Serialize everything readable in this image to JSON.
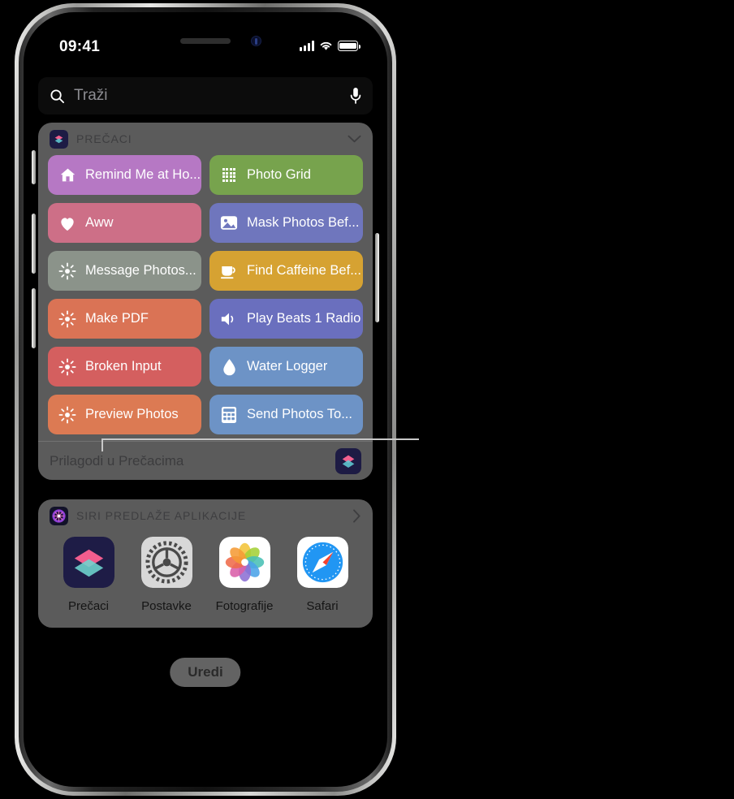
{
  "device": {
    "frame": "iphone-silver"
  },
  "status_bar": {
    "time": "09:41",
    "cellular_icon": "signal-bars-icon",
    "wifi_icon": "wifi-icon",
    "battery_icon": "battery-icon"
  },
  "search": {
    "placeholder": "Traži",
    "search_icon": "search-icon",
    "mic_icon": "microphone-icon"
  },
  "shortcuts_widget": {
    "header": "PREČACI",
    "header_icon": "shortcuts-app-icon",
    "collapse_icon": "chevron-down-icon",
    "footer_label": "Prilagodi u Prečacima",
    "footer_icon": "shortcuts-app-icon",
    "tiles": [
      {
        "label": "Remind Me at Ho...",
        "icon": "house-icon",
        "color": "#b678c4"
      },
      {
        "label": "Photo Grid",
        "icon": "grid-dots-icon",
        "color": "#77a34d"
      },
      {
        "label": "Aww",
        "icon": "heart-icon",
        "color": "#cd6f87"
      },
      {
        "label": "Mask Photos Bef...",
        "icon": "photo-icon",
        "color": "#6f76bd"
      },
      {
        "label": "Message Photos...",
        "icon": "sparkle-icon",
        "color": "#8b938a"
      },
      {
        "label": "Find Caffeine Bef...",
        "icon": "coffee-cup-icon",
        "color": "#d6a232"
      },
      {
        "label": "Make PDF",
        "icon": "sparkle-icon",
        "color": "#da7355"
      },
      {
        "label": "Play Beats 1 Radio",
        "icon": "speaker-icon",
        "color": "#6a6fbe"
      },
      {
        "label": "Broken Input",
        "icon": "sparkle-icon",
        "color": "#d45f5f"
      },
      {
        "label": "Water Logger",
        "icon": "water-drop-icon",
        "color": "#6d93c6"
      },
      {
        "label": "Preview Photos",
        "icon": "sparkle-icon",
        "color": "#dc7a53"
      },
      {
        "label": "Send Photos To...",
        "icon": "calculator-icon",
        "color": "#6d93c6"
      }
    ]
  },
  "siri_widget": {
    "header": "SIRI PREDLAŽE APLIKACIJE",
    "header_icon": "siri-icon",
    "more_icon": "chevron-right-icon",
    "apps": [
      {
        "name": "Prečaci",
        "icon": "shortcuts-app-icon"
      },
      {
        "name": "Postavke",
        "icon": "settings-app-icon"
      },
      {
        "name": "Fotografije",
        "icon": "photos-app-icon"
      },
      {
        "name": "Safari",
        "icon": "safari-app-icon"
      }
    ]
  },
  "edit_button": {
    "label": "Uredi"
  },
  "callout": {
    "target": "shortcuts-widget-footer"
  }
}
